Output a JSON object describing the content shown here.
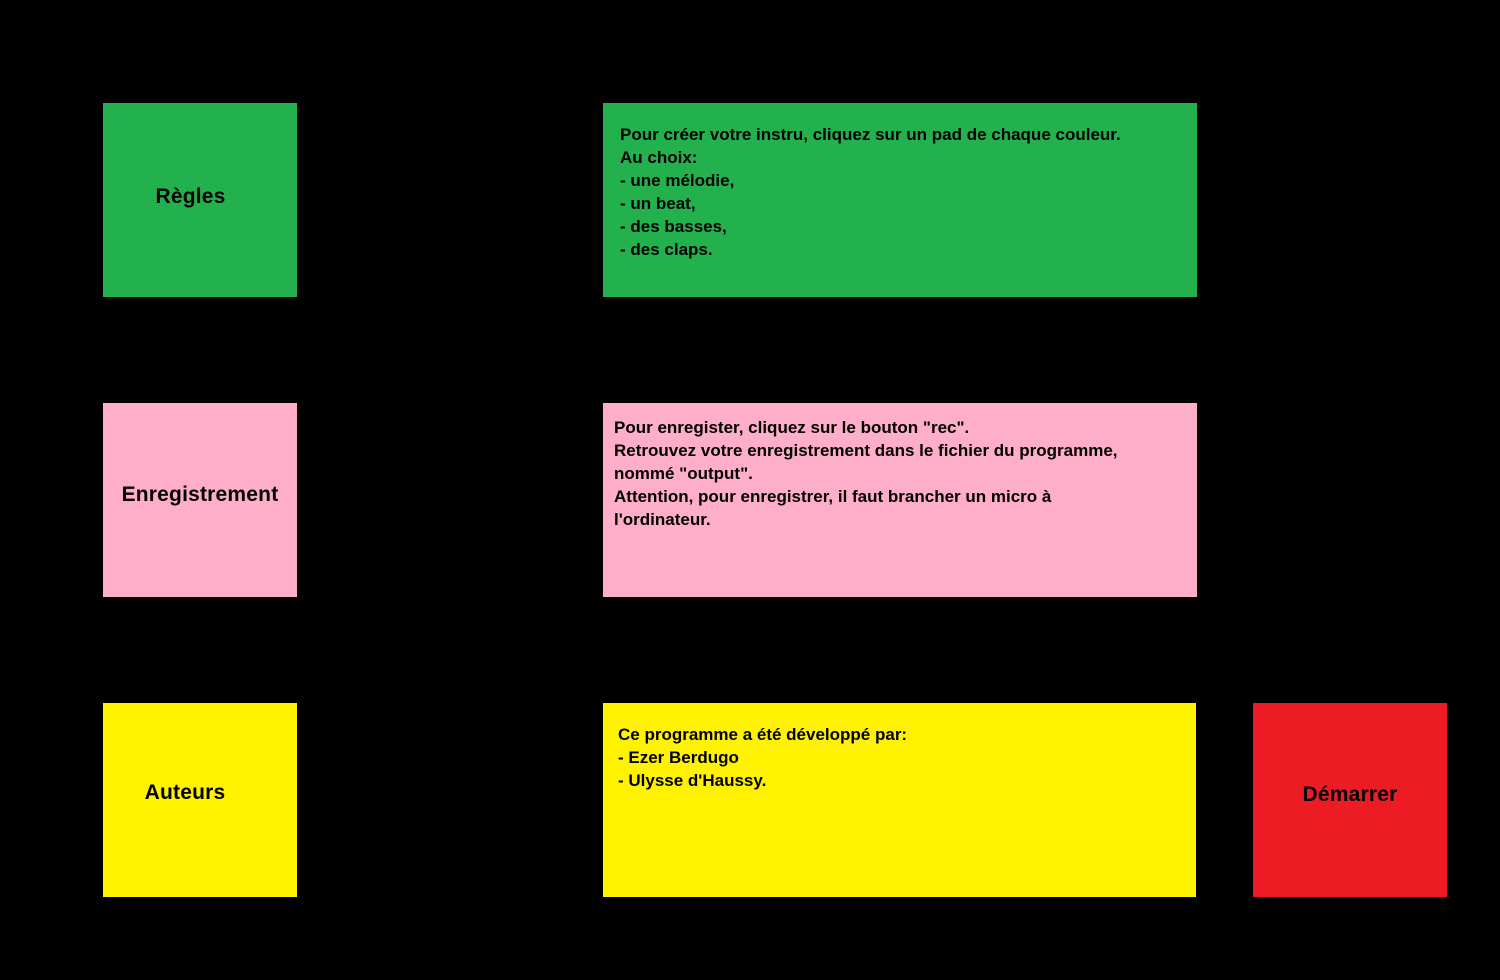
{
  "menu": {
    "regles_label": "Règles",
    "enregistrement_label": "Enregistrement",
    "auteurs_label": "Auteurs",
    "demarrer_label": "Démarrer"
  },
  "panels": {
    "regles": {
      "lines": [
        "Pour créer votre instru, cliquez sur un pad de chaque couleur.",
        "Au choix:",
        "- une mélodie,",
        "- un beat,",
        "- des basses,",
        "- des claps."
      ]
    },
    "enregistrement": {
      "lines": [
        "Pour enregister, cliquez sur le bouton \"rec\".",
        "Retrouvez votre enregistrement dans le fichier du programme, nommé \"output\".",
        "Attention, pour enregistrer, il faut brancher un micro à l'ordinateur."
      ]
    },
    "auteurs": {
      "lines": [
        "Ce programme a été développé par:",
        "- Ezer Berdugo",
        "- Ulysse d'Haussy."
      ]
    }
  },
  "colors": {
    "background": "#000000",
    "green": "#22b14c",
    "pink": "#ffaec9",
    "yellow": "#fff200",
    "red": "#ed1c24"
  }
}
